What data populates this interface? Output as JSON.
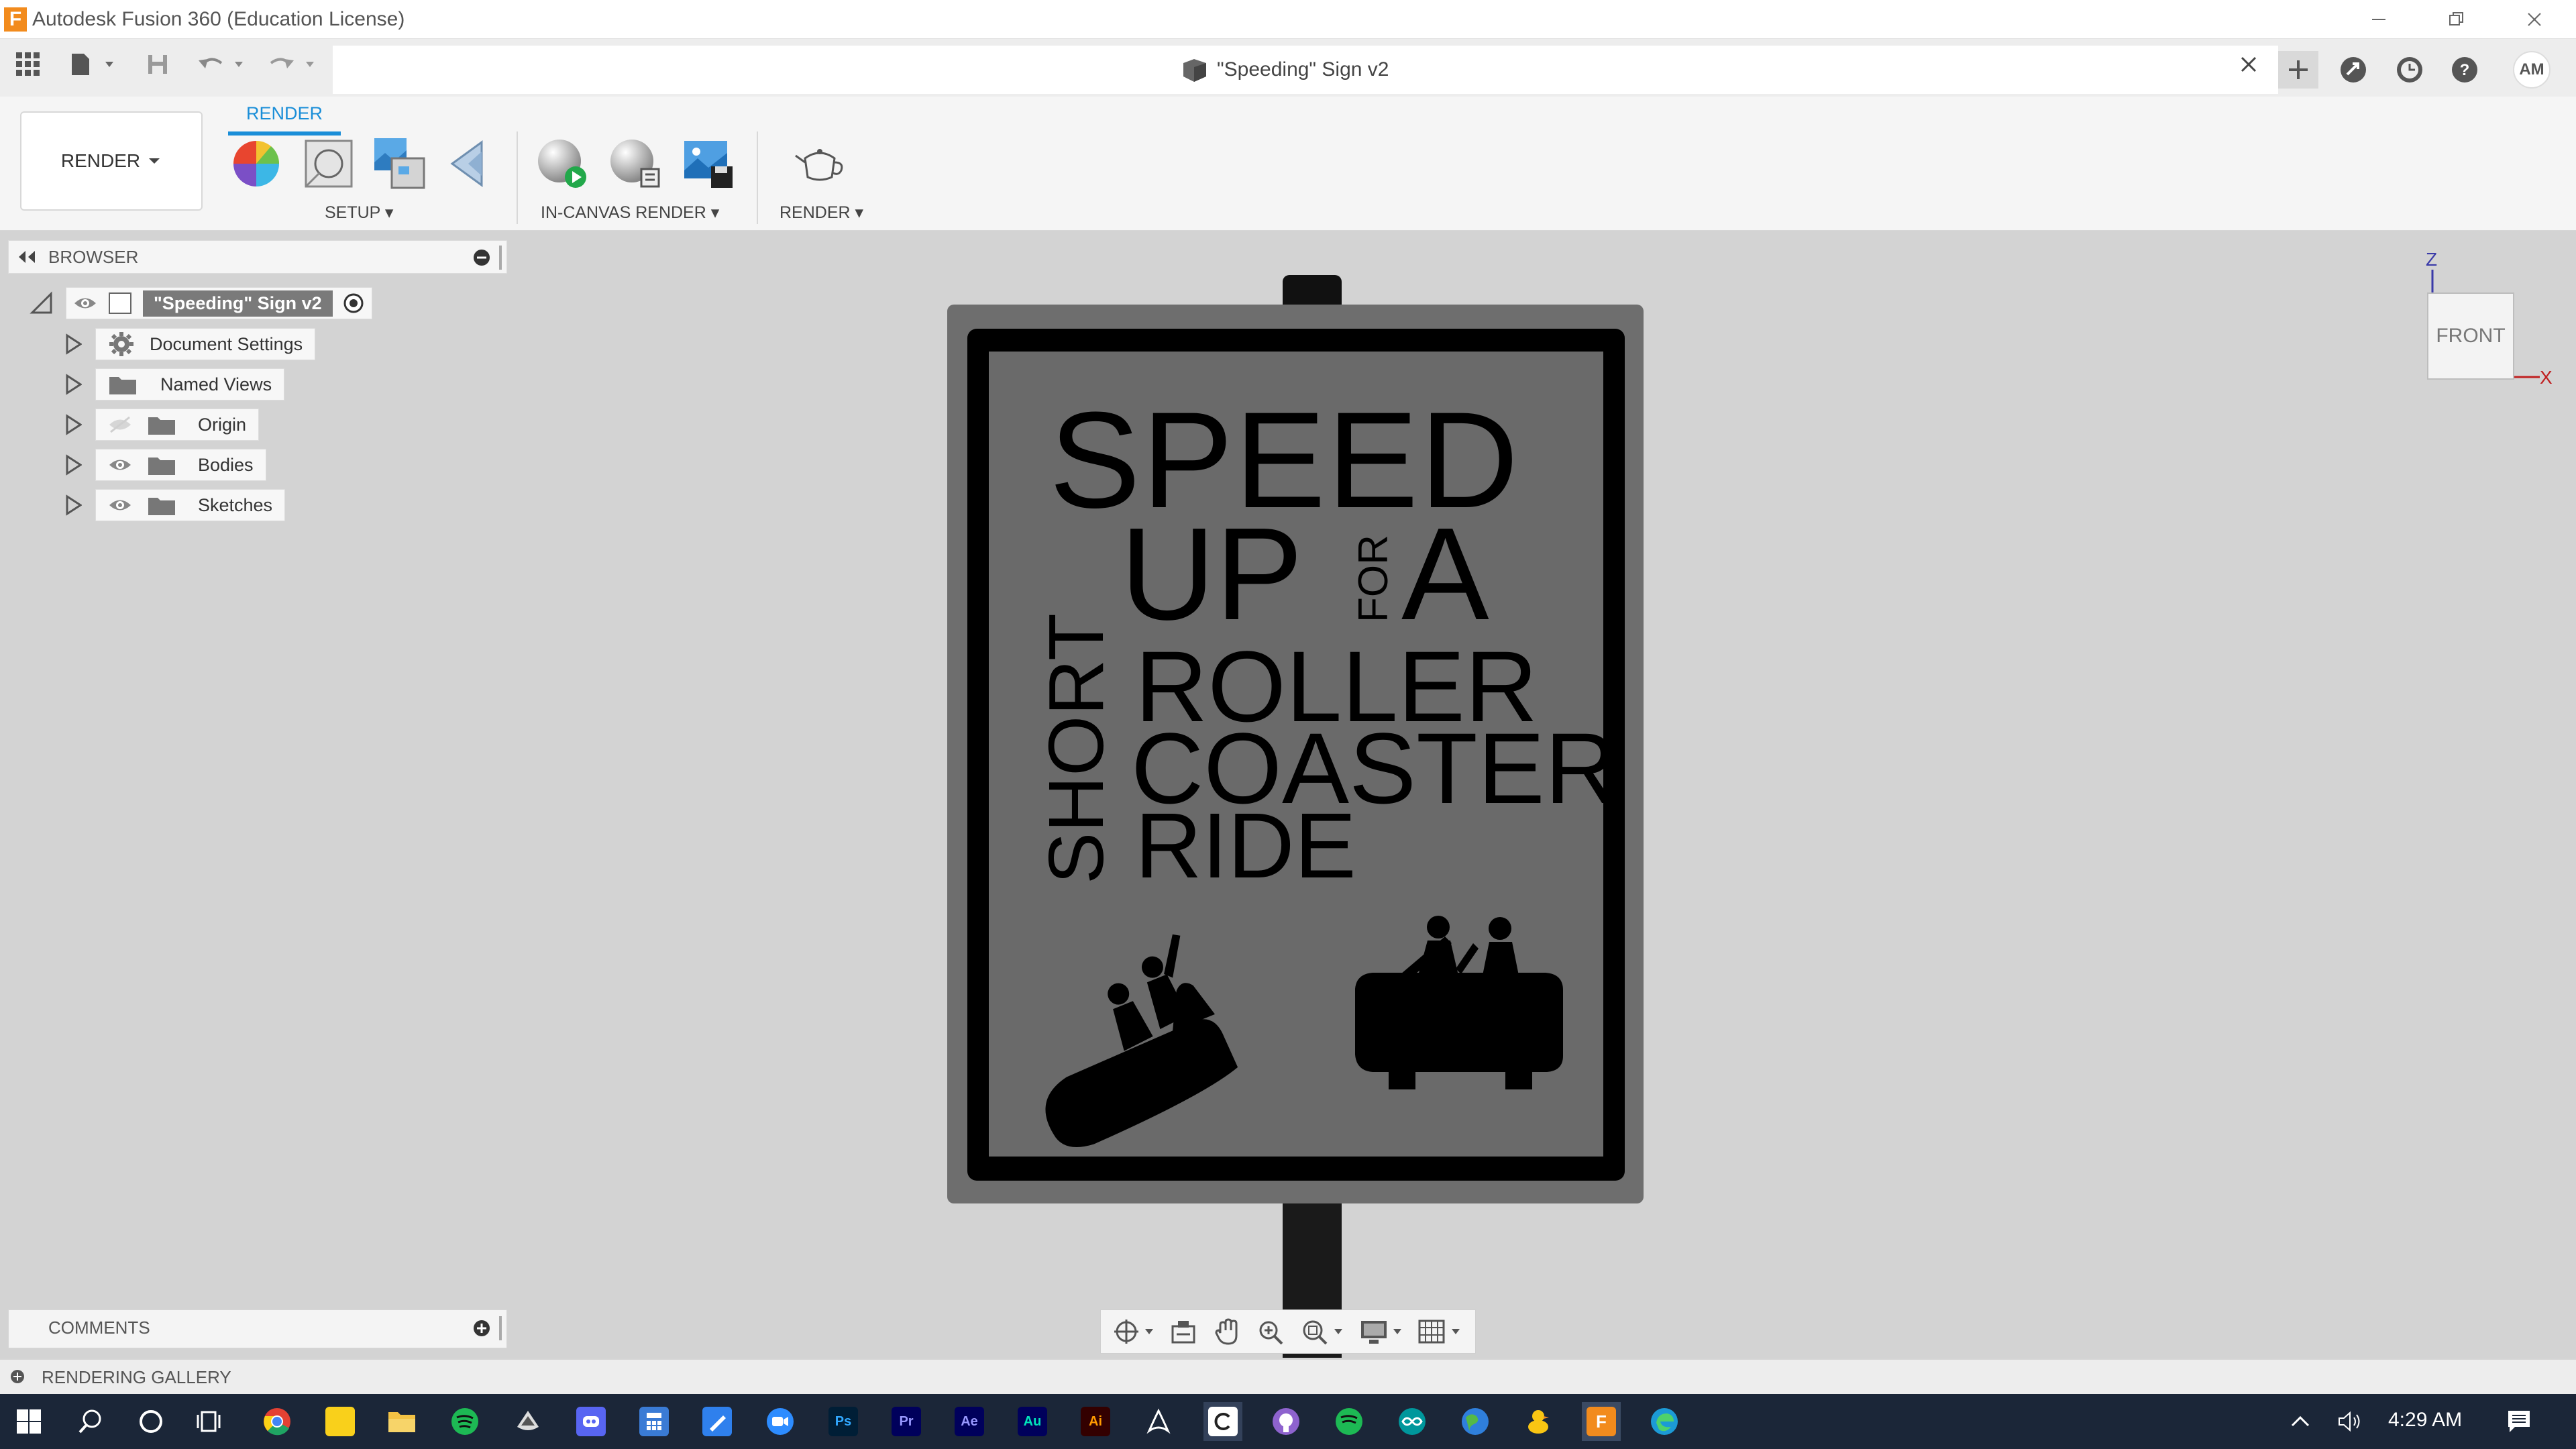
{
  "window": {
    "title": "Autodesk Fusion 360 (Education License)",
    "logo_letter": "F"
  },
  "document": {
    "title": "\"Speeding\" Sign v2",
    "user_initials": "AM"
  },
  "ribbon": {
    "workspace_label": "RENDER",
    "active_tab": "RENDER",
    "groups": {
      "setup": "SETUP",
      "in_canvas_render": "IN-CANVAS RENDER",
      "render": "RENDER"
    }
  },
  "browser": {
    "title": "BROWSER",
    "root": "\"Speeding\" Sign v2",
    "items": [
      {
        "label": "Document Settings",
        "icon": "gear-icon"
      },
      {
        "label": "Named Views",
        "icon": "folder-icon"
      },
      {
        "label": "Origin",
        "icon": "folder-icon",
        "visible": false
      },
      {
        "label": "Bodies",
        "icon": "folder-icon",
        "visible": true
      },
      {
        "label": "Sketches",
        "icon": "folder-icon",
        "visible": true
      }
    ]
  },
  "sign": {
    "line1": "SPEED",
    "line2a": "UP",
    "line2b": "FOR",
    "line2c": "A",
    "vertical": "SHORT",
    "line3": "ROLLER",
    "line4": "COASTER",
    "line5": "RIDE"
  },
  "viewcube": {
    "face": "FRONT",
    "axis_z": "Z",
    "axis_x": "X"
  },
  "panels": {
    "comments": "COMMENTS",
    "rendering_gallery": "RENDERING GALLERY"
  },
  "taskbar": {
    "clock": "4:29 AM",
    "apps": [
      {
        "name": "chrome",
        "label": ""
      },
      {
        "name": "sticky-notes",
        "label": ""
      },
      {
        "name": "file-explorer",
        "label": ""
      },
      {
        "name": "spotify",
        "label": ""
      },
      {
        "name": "inkscape",
        "label": ""
      },
      {
        "name": "discord",
        "label": ""
      },
      {
        "name": "calculator",
        "label": ""
      },
      {
        "name": "sketch",
        "label": ""
      },
      {
        "name": "zoom",
        "label": ""
      },
      {
        "name": "photoshop",
        "label": "Ps"
      },
      {
        "name": "premiere",
        "label": "Pr"
      },
      {
        "name": "after-effects",
        "label": "Ae"
      },
      {
        "name": "audition",
        "label": "Au"
      },
      {
        "name": "illustrator",
        "label": "Ai"
      },
      {
        "name": "acrobat",
        "label": ""
      },
      {
        "name": "cricut",
        "label": ""
      },
      {
        "name": "github",
        "label": ""
      },
      {
        "name": "spotify-2",
        "label": ""
      },
      {
        "name": "arduino",
        "label": ""
      },
      {
        "name": "earth",
        "label": ""
      },
      {
        "name": "duck",
        "label": ""
      },
      {
        "name": "fusion",
        "label": "F"
      },
      {
        "name": "edge",
        "label": ""
      }
    ]
  },
  "colors": {
    "accent": "#1a8ed8",
    "taskbar": "#1b2638",
    "fusion_orange": "#f28b1d"
  }
}
